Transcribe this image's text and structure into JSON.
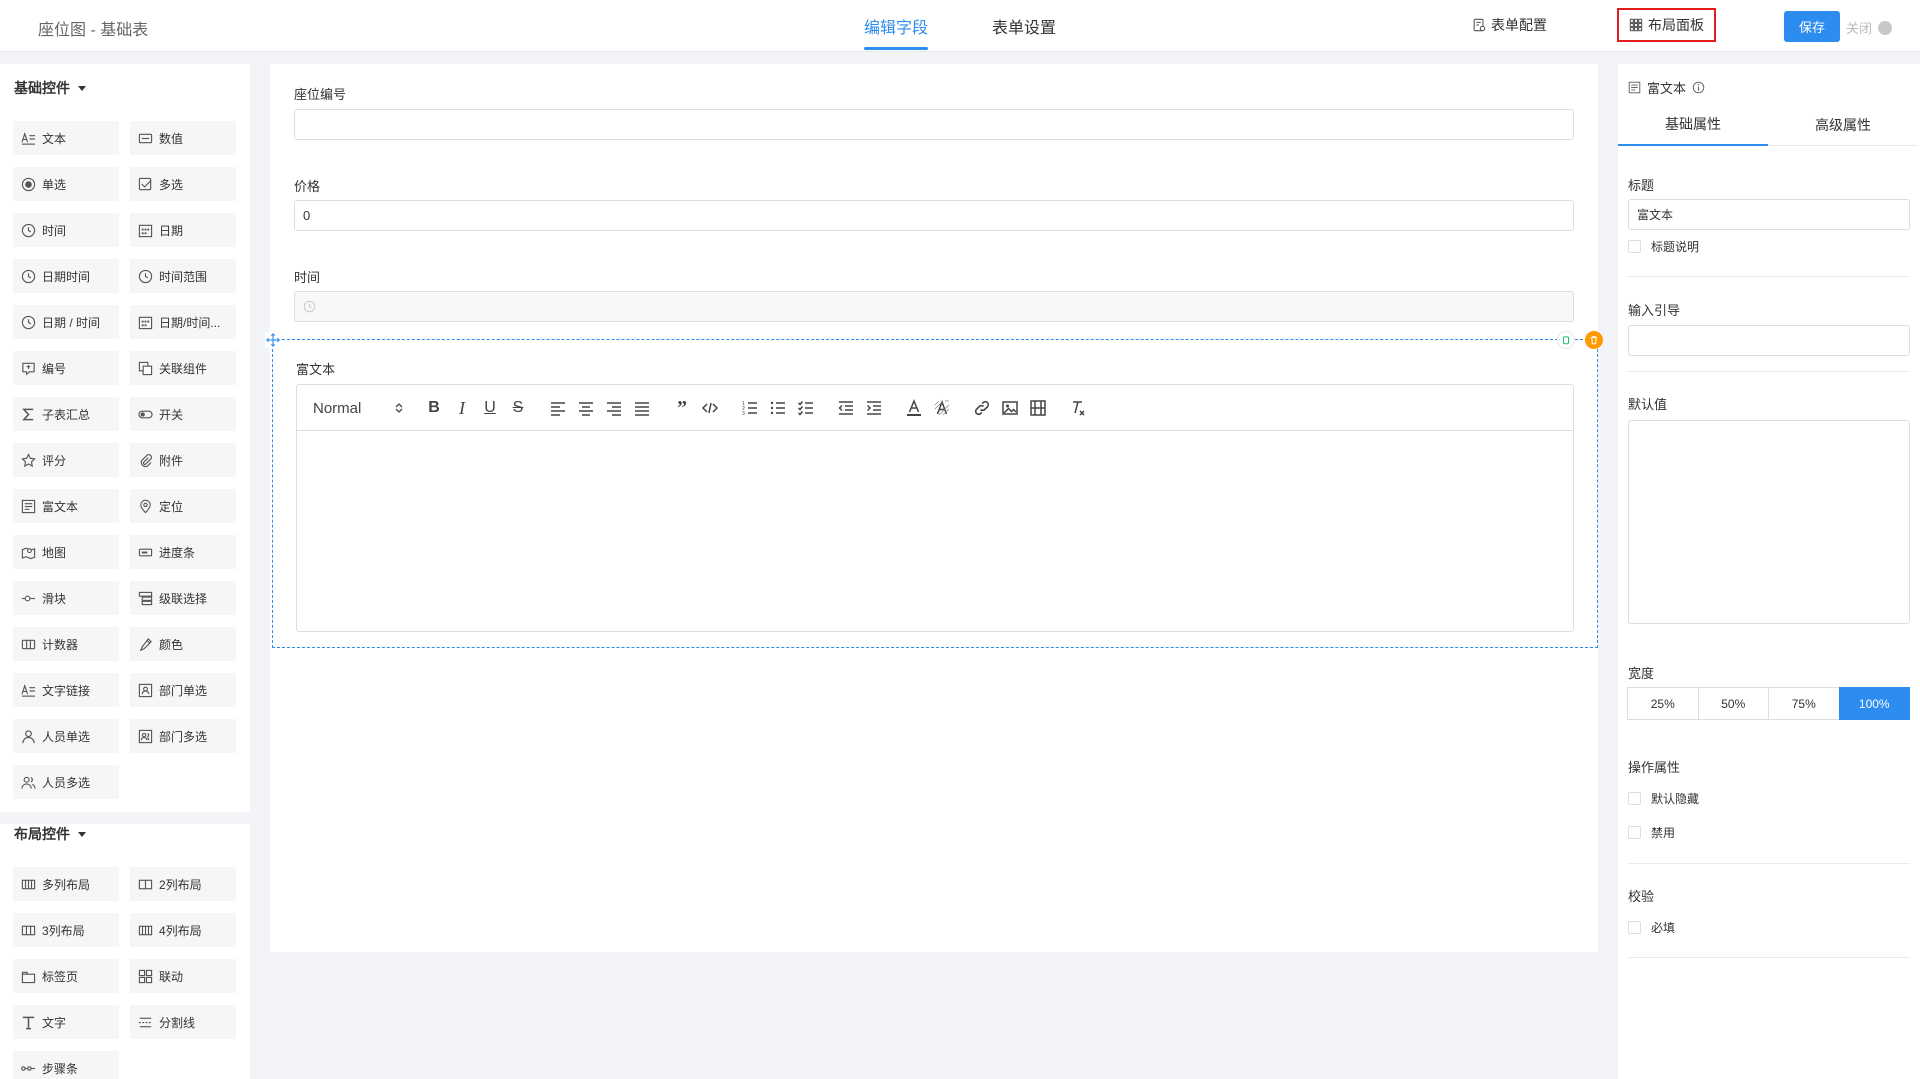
{
  "header": {
    "title": "座位图 - 基础表",
    "tabs": [
      {
        "label": "编辑字段",
        "active": true
      },
      {
        "label": "表单设置",
        "active": false
      }
    ],
    "form_config_label": "表单配置",
    "layout_panel_label": "布局面板",
    "save_label": "保存",
    "close_label": "关闭"
  },
  "left_panel": {
    "basic_section": {
      "title": "基础控件",
      "items": [
        {
          "label": "文本",
          "icon": "text-icon"
        },
        {
          "label": "数值",
          "icon": "number-icon"
        },
        {
          "label": "单选",
          "icon": "radio-icon"
        },
        {
          "label": "多选",
          "icon": "checkbox-icon"
        },
        {
          "label": "时间",
          "icon": "clock-icon"
        },
        {
          "label": "日期",
          "icon": "calendar-icon"
        },
        {
          "label": "日期时间",
          "icon": "clock-icon"
        },
        {
          "label": "时间范围",
          "icon": "clock-icon"
        },
        {
          "label": "日期 / 时间",
          "icon": "clock-icon"
        },
        {
          "label": "日期/时间...",
          "icon": "calendar-icon"
        },
        {
          "label": "编号",
          "icon": "serial-icon"
        },
        {
          "label": "关联组件",
          "icon": "link-component-icon"
        },
        {
          "label": "子表汇总",
          "icon": "sigma-icon"
        },
        {
          "label": "开关",
          "icon": "switch-icon"
        },
        {
          "label": "评分",
          "icon": "star-icon"
        },
        {
          "label": "附件",
          "icon": "paperclip-icon"
        },
        {
          "label": "富文本",
          "icon": "richtext-icon"
        },
        {
          "label": "定位",
          "icon": "location-icon"
        },
        {
          "label": "地图",
          "icon": "map-icon"
        },
        {
          "label": "进度条",
          "icon": "progress-icon"
        },
        {
          "label": "滑块",
          "icon": "slider-icon"
        },
        {
          "label": "级联选择",
          "icon": "cascader-icon"
        },
        {
          "label": "计数器",
          "icon": "counter-icon"
        },
        {
          "label": "颜色",
          "icon": "color-picker-icon"
        },
        {
          "label": "文字链接",
          "icon": "text-link-icon"
        },
        {
          "label": "部门单选",
          "icon": "department-icon"
        },
        {
          "label": "人员单选",
          "icon": "user-icon"
        },
        {
          "label": "部门多选",
          "icon": "department-multi-icon"
        },
        {
          "label": "人员多选",
          "icon": "users-icon"
        }
      ]
    },
    "layout_section": {
      "title": "布局控件",
      "items": [
        {
          "label": "多列布局",
          "icon": "columns-icon"
        },
        {
          "label": "2列布局",
          "icon": "two-columns-icon"
        },
        {
          "label": "3列布局",
          "icon": "three-columns-icon"
        },
        {
          "label": "4列布局",
          "icon": "four-columns-icon"
        },
        {
          "label": "标签页",
          "icon": "tabs-icon"
        },
        {
          "label": "联动",
          "icon": "linkage-icon"
        },
        {
          "label": "文字",
          "icon": "text-t-icon"
        },
        {
          "label": "分割线",
          "icon": "divider-icon"
        },
        {
          "label": "步骤条",
          "icon": "steps-icon"
        }
      ]
    }
  },
  "canvas": {
    "fields": [
      {
        "label": "座位编号",
        "value": ""
      },
      {
        "label": "价格",
        "value": "0"
      },
      {
        "label": "时间",
        "value": ""
      }
    ],
    "richtext": {
      "label": "富文本",
      "header_select": "Normal"
    }
  },
  "right_panel": {
    "title": "富文本",
    "tabs": [
      "基础属性",
      "高级属性"
    ],
    "title_label": "标题",
    "title_value": "富文本",
    "title_desc_label": "标题说明",
    "guide_label": "输入引导",
    "default_label": "默认值",
    "width_label": "宽度",
    "width_options": [
      "25%",
      "50%",
      "75%",
      "100%"
    ],
    "width_selected": "100%",
    "ops_label": "操作属性",
    "hide_label": "默认隐藏",
    "disable_label": "禁用",
    "validate_label": "校验",
    "required_label": "必填"
  },
  "colors": {
    "accent": "#2d8cf0",
    "highlight_border": "#e01c1c",
    "delete": "#ff9900"
  }
}
